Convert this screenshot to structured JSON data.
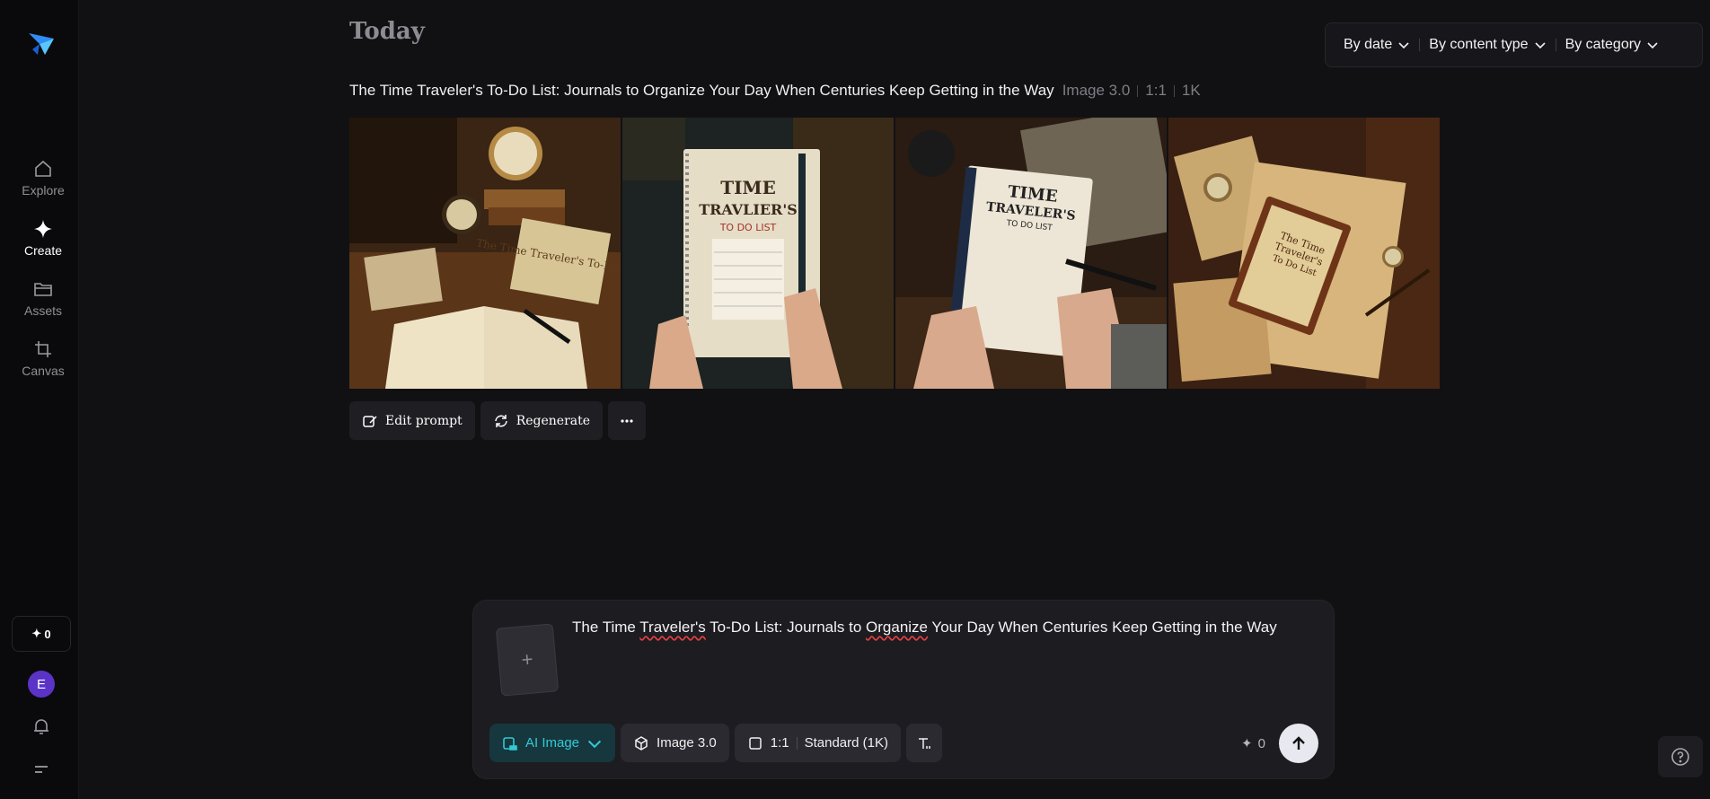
{
  "sidebar": {
    "items": [
      {
        "label": "Explore",
        "icon": "home-icon"
      },
      {
        "label": "Create",
        "icon": "sparkle-icon"
      },
      {
        "label": "Assets",
        "icon": "folder-icon"
      },
      {
        "label": "Canvas",
        "icon": "crop-icon"
      }
    ],
    "credits": "0",
    "avatar_initial": "E"
  },
  "header": {
    "title": "Today",
    "filters": [
      "By date",
      "By content type",
      "By category"
    ]
  },
  "generation": {
    "prompt": "The Time Traveler's To-Do List: Journals to Organize Your Day When Centuries Keep Getting in the Way",
    "model": "Image 3.0",
    "ratio": "1:1",
    "resolution": "1K",
    "thumbnails": [
      {
        "title": "The Time Traveler's To-Do List"
      },
      {
        "title_line1": "TIME",
        "title_line2": "TRAVLIER'S",
        "subtitle": "TO DO LIST"
      },
      {
        "title_line1": "TIME",
        "title_line2": "TRAVELER'S",
        "subtitle": "TO DO LIST"
      },
      {
        "title_line1": "The Time",
        "title_line2": "Traveler's",
        "subtitle": "To Do List"
      }
    ],
    "actions": {
      "edit": "Edit prompt",
      "regenerate": "Regenerate"
    }
  },
  "composer": {
    "text_parts": [
      "The Time ",
      "Traveler's",
      " To-Do List: Journals to ",
      "Organize",
      " Your Day When Centuries Keep Getting in the Way"
    ],
    "mode": "AI Image",
    "model": "Image 3.0",
    "ratio": "1:1",
    "quality": "Standard (1K)",
    "cost": "0"
  },
  "colors": {
    "accent": "#33c9d6",
    "avatar": "#5b34c7",
    "background": "#111114"
  }
}
